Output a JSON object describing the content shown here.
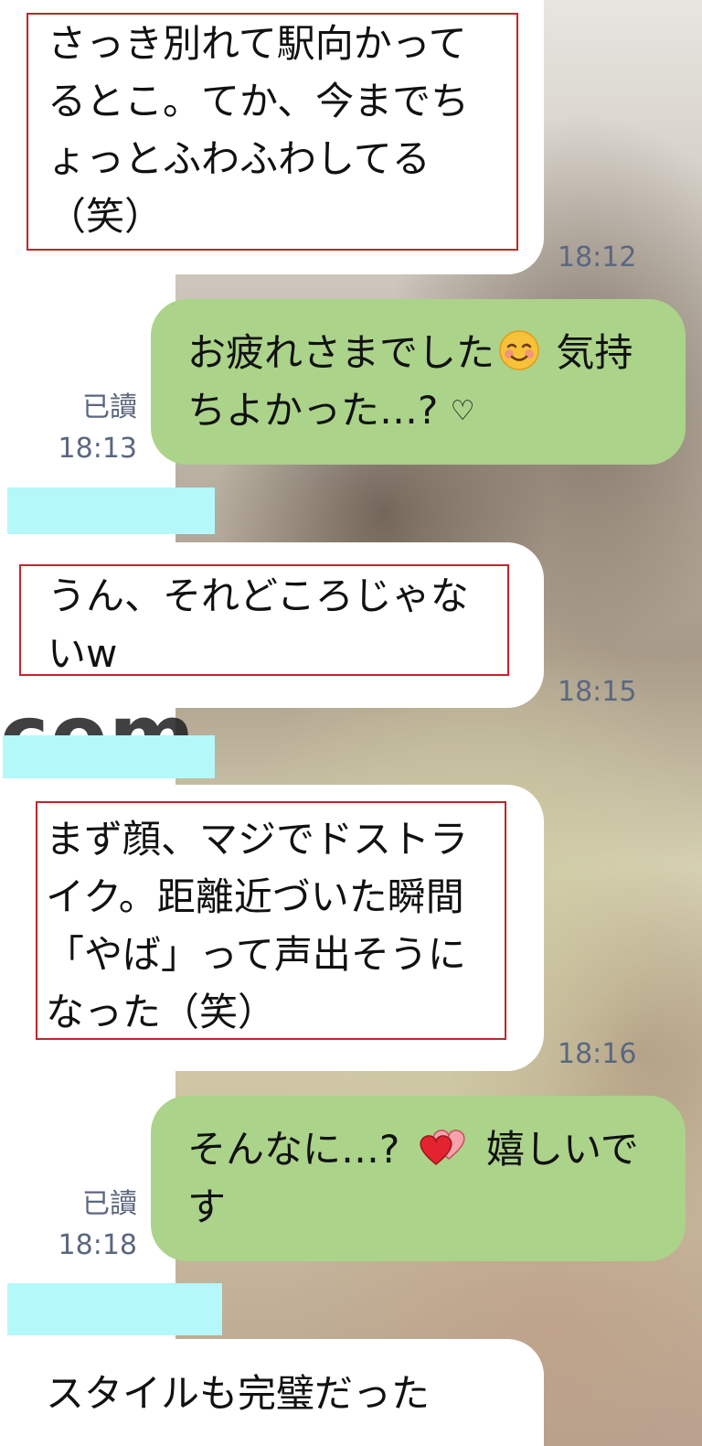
{
  "messages": [
    {
      "id": "m1",
      "side": "incoming",
      "text": "さっき別れて駅向かってるとこ。てか、今までちょっとふわふわしてる（笑）",
      "time": "18:12"
    },
    {
      "id": "m2",
      "side": "outgoing",
      "text_a": "お疲れさまでした",
      "emoji": "smiling-face-icon",
      "text_b": " 気持ちよかった…? ",
      "heart": "♡",
      "read": "已讀",
      "time": "18:13"
    },
    {
      "id": "m3",
      "side": "incoming",
      "text": "うん、それどころじゃないw",
      "time": "18:15"
    },
    {
      "id": "m4",
      "side": "incoming",
      "text": "まず顔、マジでドストライク。距離近づいた瞬間「やば」って声出そうになった（笑）",
      "time": "18:16"
    },
    {
      "id": "m5",
      "side": "outgoing",
      "text_a": "そんなに…? ",
      "emoji": "two-hearts-icon",
      "text_b": " 嬉しいです",
      "read": "已讀",
      "time": "18:18"
    },
    {
      "id": "m6",
      "side": "incoming",
      "text": "スタイルも完璧だった"
    }
  ],
  "watermark": "com",
  "colors": {
    "incoming_bubble": "#ffffff",
    "outgoing_bubble": "#acd38a",
    "highlight_box": "#c0262a",
    "redaction": "#b4f8fa",
    "meta_text": "#5b6780"
  }
}
